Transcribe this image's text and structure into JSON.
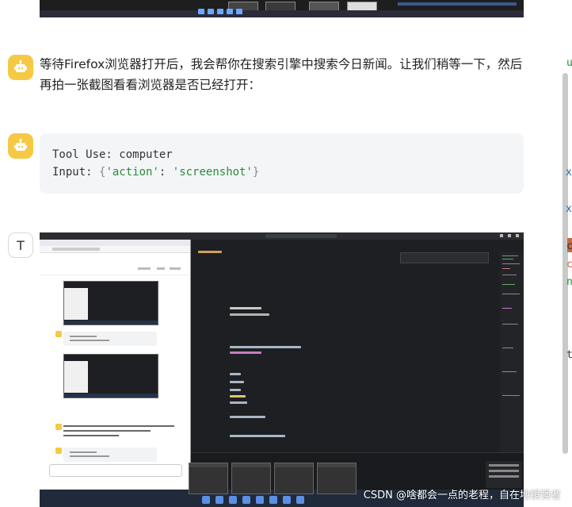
{
  "messages": [
    {
      "role": "assistant",
      "avatar_icon": "robot-icon",
      "text": "等待Firefox浏览器打开后，我会帮你在搜索引擎中搜索今日新闻。让我们稍等一下，然后再拍一张截图看看浏览器是否已经打开："
    },
    {
      "role": "assistant",
      "avatar_icon": "robot-icon",
      "tool_use_label": "Tool Use:",
      "tool_name": "computer",
      "input_label": "Input:",
      "input_open": "{",
      "input_key": "'action'",
      "input_colon": ":",
      "input_value": "'screenshot'",
      "input_close": "}"
    },
    {
      "role": "user",
      "avatar_letter": "T"
    }
  ],
  "watermark": "CSDN @啥都会一点的老程，自在地镜强者",
  "side_fragments": [
    "u",
    "x",
    "x",
    "c",
    "c",
    "n",
    "t"
  ],
  "colors": {
    "avatar_bg": "#f6c945",
    "code_bg": "#f4f5f7",
    "string_green": "#2a8a3e"
  }
}
